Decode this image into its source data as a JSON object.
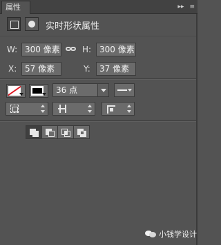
{
  "panel": {
    "tab_label": "属性",
    "header_icons": [
      "collapse-icon",
      "menu-icon"
    ],
    "header_icon_glyphs": [
      "▸▸",
      "≡"
    ]
  },
  "live_shape": {
    "title": "实时形状属性"
  },
  "dimensions": {
    "w_label": "W:",
    "w_value": "300 像素",
    "h_label": "H:",
    "h_value": "300 像素",
    "x_label": "X:",
    "x_value": "57 像素",
    "y_label": "Y:",
    "y_value": "37 像素"
  },
  "stroke": {
    "size_value": "36 点",
    "fill_swatch": "none",
    "stroke_swatch": "black"
  },
  "watermark": {
    "text": "小钱学设计"
  },
  "colors": {
    "panel_bg": "#535353",
    "header_bg": "#424242",
    "field_bg": "#6b6b6b"
  }
}
